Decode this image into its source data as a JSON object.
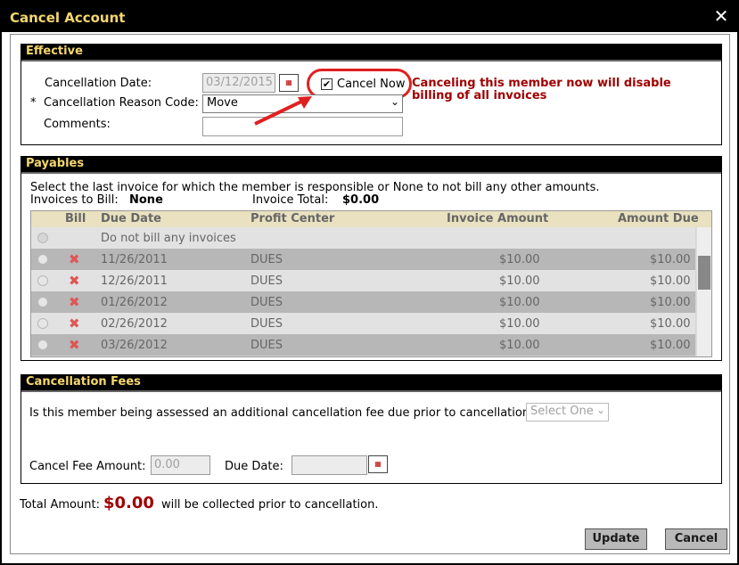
{
  "dialog": {
    "title": "Cancel Account"
  },
  "effective": {
    "header": "Effective",
    "cancellation_date_label": "Cancellation Date:",
    "cancellation_date_value": "03/12/2015",
    "cancel_now_label": "Cancel Now",
    "cancel_now_checked": true,
    "warning": "Canceling this member now will disable billing of all invoices",
    "reason_required_mark": "*",
    "reason_label": "Cancellation Reason Code:",
    "reason_value": "Move",
    "comments_label": "Comments:",
    "comments_value": ""
  },
  "payables": {
    "header": "Payables",
    "instructions": "Select the last invoice for which the member is responsible or None to not bill any other amounts.",
    "invoices_to_bill_label": "Invoices to Bill:",
    "invoices_to_bill_value": "None",
    "invoice_total_label": "Invoice Total:",
    "invoice_total_value": "$0.00",
    "columns": [
      "Bill",
      "Due Date",
      "Profit Center",
      "Invoice Amount",
      "Amount Due"
    ],
    "none_row": "Do not bill any invoices",
    "rows": [
      {
        "due_date": "11/26/2011",
        "profit_center": "DUES",
        "invoice_amount": "$10.00",
        "amount_due": "$10.00"
      },
      {
        "due_date": "12/26/2011",
        "profit_center": "DUES",
        "invoice_amount": "$10.00",
        "amount_due": "$10.00"
      },
      {
        "due_date": "01/26/2012",
        "profit_center": "DUES",
        "invoice_amount": "$10.00",
        "amount_due": "$10.00"
      },
      {
        "due_date": "02/26/2012",
        "profit_center": "DUES",
        "invoice_amount": "$10.00",
        "amount_due": "$10.00"
      },
      {
        "due_date": "03/26/2012",
        "profit_center": "DUES",
        "invoice_amount": "$10.00",
        "amount_due": "$10.00"
      }
    ]
  },
  "fees": {
    "header": "Cancellation Fees",
    "question": "Is this member being assessed an additional cancellation fee due prior to cancellation?",
    "select_value": "Select One",
    "fee_amount_label": "Cancel Fee Amount:",
    "fee_amount_value": "0.00",
    "due_date_label": "Due Date:",
    "due_date_value": ""
  },
  "total": {
    "label": "Total Amount:",
    "value": "$0.00",
    "suffix": "will be collected prior to cancellation."
  },
  "buttons": {
    "update": "Update",
    "cancel": "Cancel"
  },
  "icons": {
    "close": "close-icon",
    "calendar": "calendar-icon",
    "remove": "remove-x-icon"
  },
  "colors": {
    "header_bg": "#000000",
    "header_text": "#f5d76e",
    "warning": "#a00000",
    "highlight": "#e02020"
  }
}
